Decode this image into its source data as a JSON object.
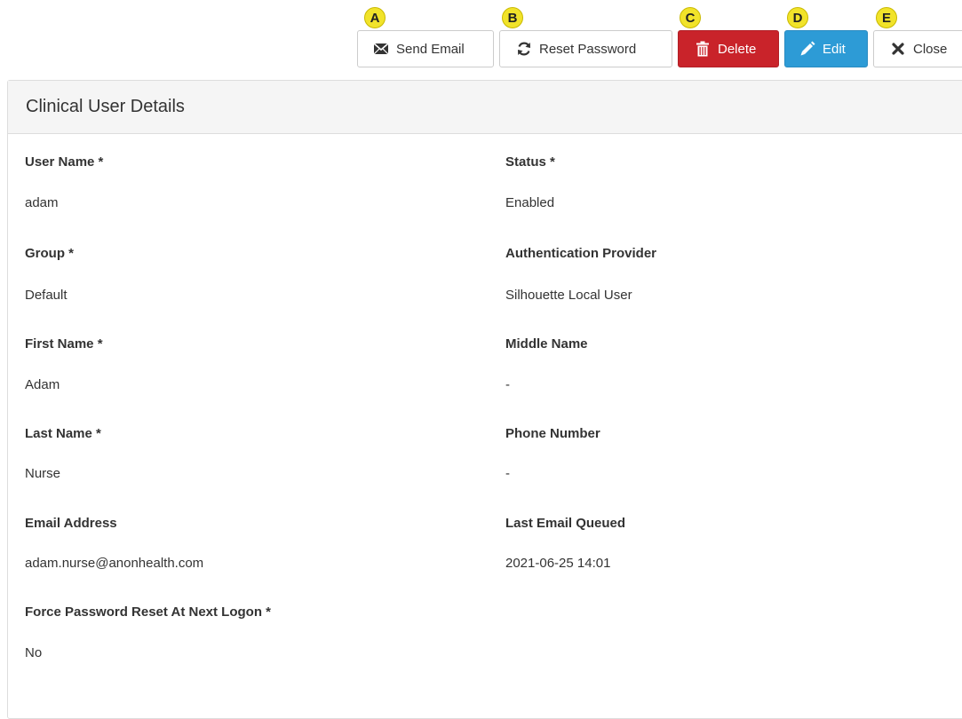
{
  "toolbar": {
    "send_email": "Send Email",
    "reset_password": "Reset Password",
    "delete": "Delete",
    "edit": "Edit",
    "close": "Close",
    "badges": [
      "A",
      "B",
      "C",
      "D",
      "E"
    ]
  },
  "panel": {
    "title": "Clinical User Details"
  },
  "fields": {
    "user_name": {
      "label": "User Name *",
      "value": "adam"
    },
    "status": {
      "label": "Status *",
      "value": "Enabled"
    },
    "group": {
      "label": "Group *",
      "value": "Default"
    },
    "auth_provider": {
      "label": "Authentication Provider",
      "value": "Silhouette Local User"
    },
    "first_name": {
      "label": "First Name *",
      "value": "Adam"
    },
    "middle_name": {
      "label": "Middle Name",
      "value": "-"
    },
    "last_name": {
      "label": "Last Name *",
      "value": "Nurse"
    },
    "phone_number": {
      "label": "Phone Number",
      "value": "-"
    },
    "email_address": {
      "label": "Email Address",
      "value": "adam.nurse@anonhealth.com"
    },
    "last_email_queued": {
      "label": "Last Email Queued",
      "value": "2021-06-25 14:01"
    },
    "force_password_reset": {
      "label": "Force Password Reset At Next Logon *",
      "value": "No"
    }
  },
  "icons": {
    "send_email": "envelope-icon",
    "reset_password": "refresh-icon",
    "delete": "trash-icon",
    "edit": "pencil-icon",
    "close": "close-icon"
  },
  "colors": {
    "delete_bg": "#c9232a",
    "edit_bg": "#2d9bd6",
    "badge_bg": "#f1e32a"
  }
}
